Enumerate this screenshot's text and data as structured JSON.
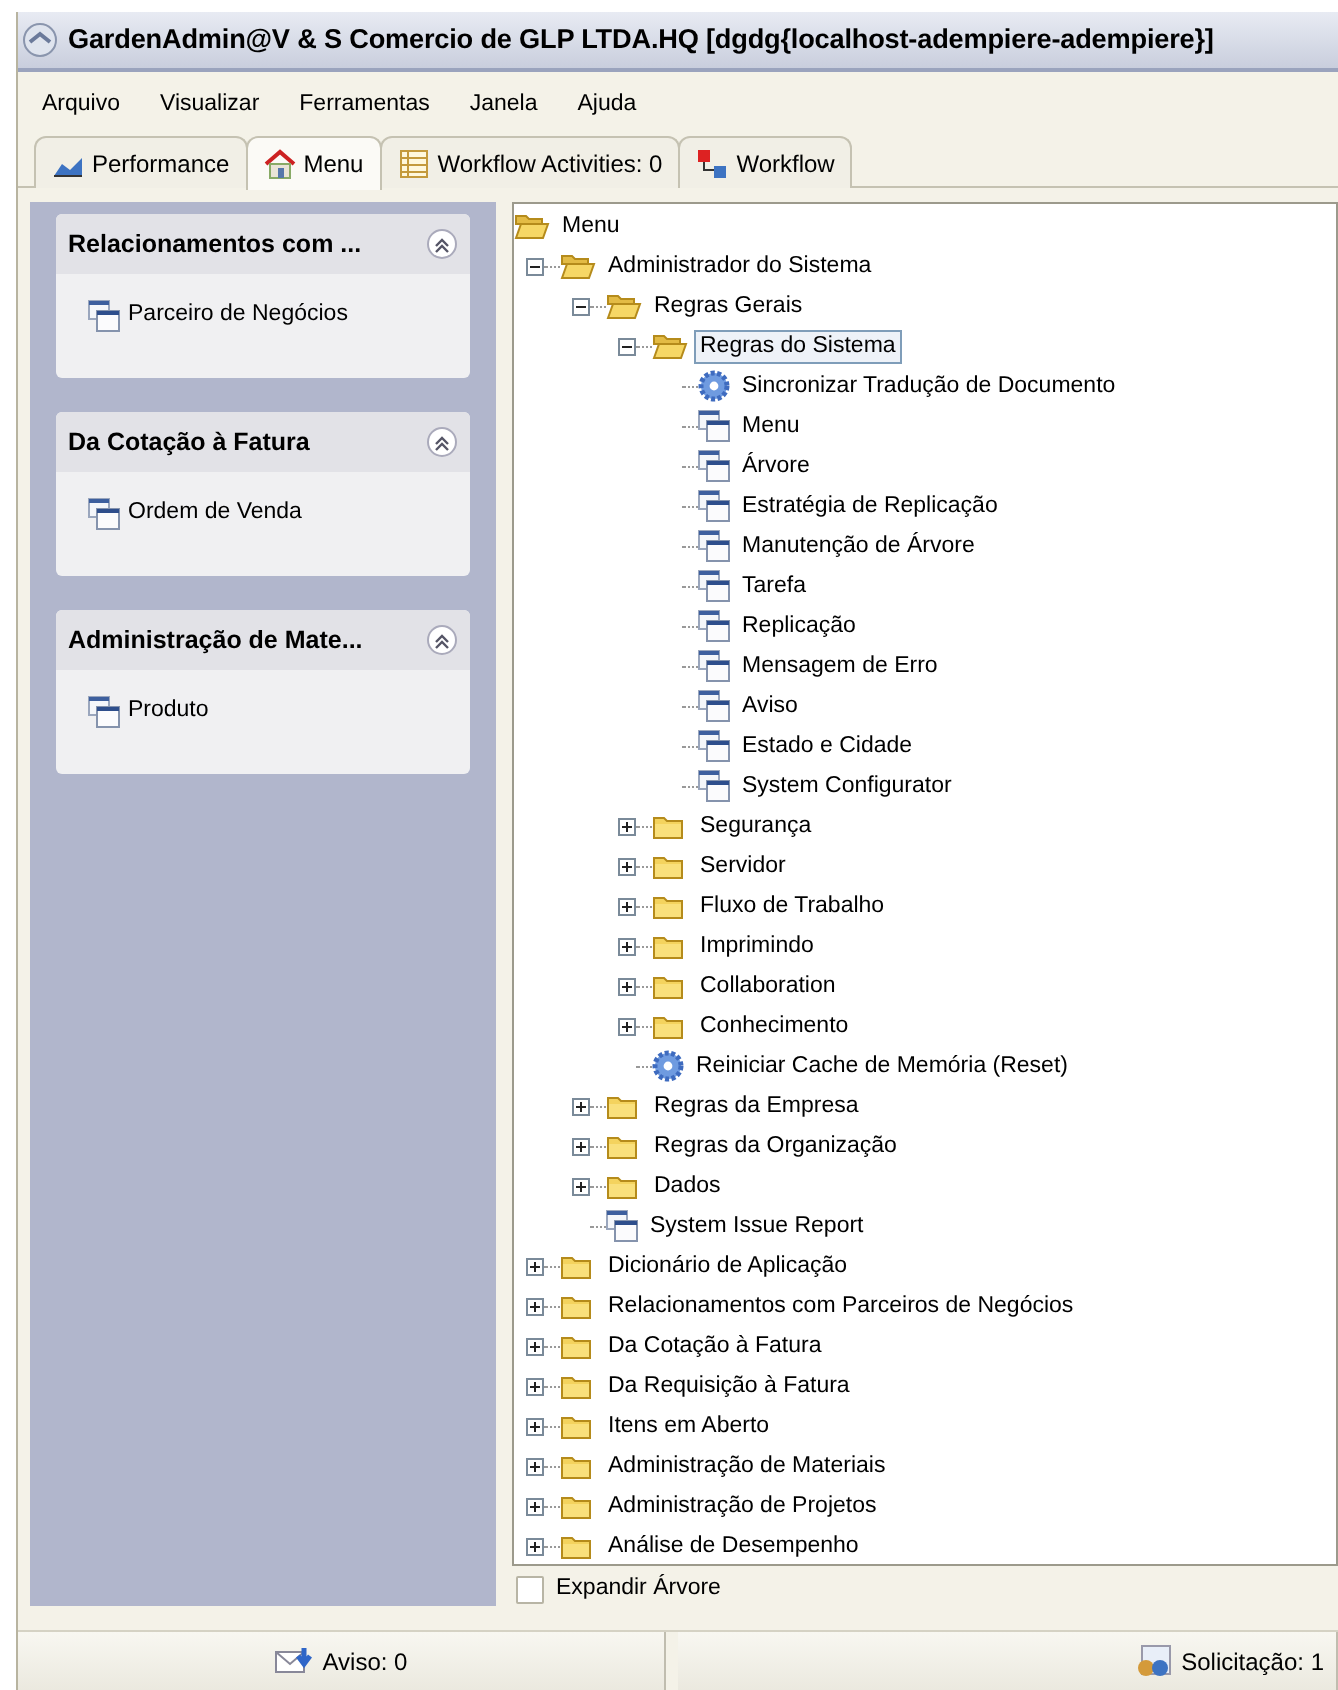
{
  "window": {
    "title": "GardenAdmin@V & S Comercio de GLP LTDA.HQ [dgdg{localhost-adempiere-adempiere}]"
  },
  "menu_bar": [
    "Arquivo",
    "Visualizar",
    "Ferramentas",
    "Janela",
    "Ajuda"
  ],
  "tabs": [
    {
      "label": "Performance",
      "kind": "performance",
      "selected": false
    },
    {
      "label": "Menu",
      "kind": "home",
      "selected": true
    },
    {
      "label": "Workflow Activities: 0",
      "kind": "activities",
      "selected": false
    },
    {
      "label": "Workflow",
      "kind": "workflow",
      "selected": false
    }
  ],
  "sidebar": {
    "groups": [
      {
        "title": "Relacionamentos com ...",
        "expanded": true,
        "items": [
          {
            "label": "Parceiro de Negócios"
          }
        ]
      },
      {
        "title": "Da Cotação à Fatura",
        "expanded": true,
        "items": [
          {
            "label": "Ordem de Venda"
          }
        ]
      },
      {
        "title": "Administração de Mate...",
        "expanded": true,
        "items": [
          {
            "label": "Produto"
          }
        ]
      }
    ]
  },
  "tree": {
    "root": {
      "label": "Menu",
      "kind": "folder",
      "expanded": true,
      "selected": false,
      "children": [
        {
          "label": "Administrador do Sistema",
          "kind": "folder",
          "expanded": true,
          "selected": false,
          "children": [
            {
              "label": "Regras Gerais",
              "kind": "folder",
              "expanded": true,
              "selected": false,
              "children": [
                {
                  "label": "Regras do Sistema",
                  "kind": "folder",
                  "expanded": true,
                  "selected": true,
                  "children": [
                    {
                      "label": "Sincronizar Tradução de Documento",
                      "kind": "process",
                      "selected": false
                    },
                    {
                      "label": "Menu",
                      "kind": "window",
                      "selected": false
                    },
                    {
                      "label": "Árvore",
                      "kind": "window",
                      "selected": false
                    },
                    {
                      "label": "Estratégia de Replicação",
                      "kind": "window",
                      "selected": false
                    },
                    {
                      "label": "Manutenção de Árvore",
                      "kind": "window",
                      "selected": false
                    },
                    {
                      "label": "Tarefa",
                      "kind": "window",
                      "selected": false
                    },
                    {
                      "label": "Replicação",
                      "kind": "window",
                      "selected": false
                    },
                    {
                      "label": "Mensagem de Erro",
                      "kind": "window",
                      "selected": false
                    },
                    {
                      "label": "Aviso",
                      "kind": "window",
                      "selected": false
                    },
                    {
                      "label": "Estado e Cidade",
                      "kind": "window",
                      "selected": false
                    },
                    {
                      "label": "System Configurator",
                      "kind": "window",
                      "selected": false
                    }
                  ]
                },
                {
                  "label": "Segurança",
                  "kind": "folder",
                  "expanded": false,
                  "selected": false
                },
                {
                  "label": "Servidor",
                  "kind": "folder",
                  "expanded": false,
                  "selected": false
                },
                {
                  "label": "Fluxo de Trabalho",
                  "kind": "folder",
                  "expanded": false,
                  "selected": false
                },
                {
                  "label": "Imprimindo",
                  "kind": "folder",
                  "expanded": false,
                  "selected": false
                },
                {
                  "label": "Collaboration",
                  "kind": "folder",
                  "expanded": false,
                  "selected": false
                },
                {
                  "label": "Conhecimento",
                  "kind": "folder",
                  "expanded": false,
                  "selected": false
                },
                {
                  "label": "Reiniciar Cache de Memória (Reset)",
                  "kind": "process",
                  "selected": false
                }
              ]
            },
            {
              "label": "Regras da Empresa",
              "kind": "folder",
              "expanded": false,
              "selected": false
            },
            {
              "label": "Regras da Organização",
              "kind": "folder",
              "expanded": false,
              "selected": false
            },
            {
              "label": "Dados",
              "kind": "folder",
              "expanded": false,
              "selected": false
            },
            {
              "label": "System Issue Report",
              "kind": "window",
              "selected": false
            }
          ]
        },
        {
          "label": "Dicionário de Aplicação",
          "kind": "folder",
          "expanded": false,
          "selected": false
        },
        {
          "label": "Relacionamentos com Parceiros de Negócios",
          "kind": "folder",
          "expanded": false,
          "selected": false
        },
        {
          "label": "Da Cotação à Fatura",
          "kind": "folder",
          "expanded": false,
          "selected": false
        },
        {
          "label": "Da Requisição à Fatura",
          "kind": "folder",
          "expanded": false,
          "selected": false
        },
        {
          "label": "Itens em Aberto",
          "kind": "folder",
          "expanded": false,
          "selected": false
        },
        {
          "label": "Administração de Materiais",
          "kind": "folder",
          "expanded": false,
          "selected": false
        },
        {
          "label": "Administração de Projetos",
          "kind": "folder",
          "expanded": false,
          "selected": false
        },
        {
          "label": "Análise de Desempenho",
          "kind": "folder",
          "expanded": false,
          "selected": false
        }
      ]
    }
  },
  "expand_tree": {
    "label": "Expandir Árvore",
    "checked": false
  },
  "status_bar": [
    {
      "label": "Aviso: 0",
      "kind": "notice"
    },
    {
      "label": "Solicitação: 1",
      "kind": "request"
    }
  ]
}
